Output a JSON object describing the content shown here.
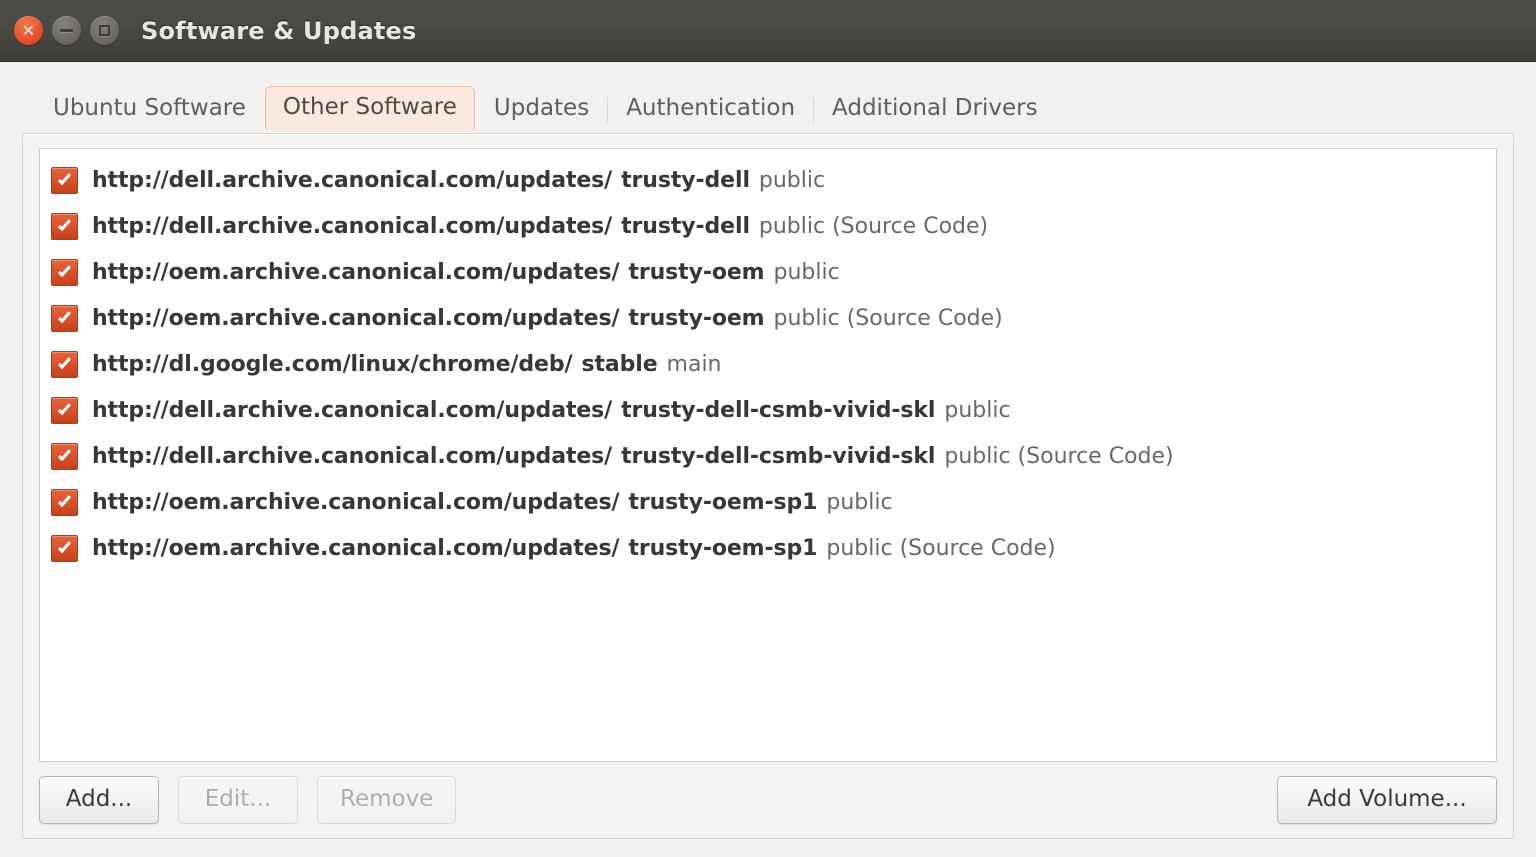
{
  "window": {
    "title": "Software & Updates",
    "controls": [
      {
        "name": "close",
        "icon": "close-icon",
        "glyph": "✕"
      },
      {
        "name": "minimize",
        "icon": "minimize-icon",
        "glyph": ""
      },
      {
        "name": "maximize",
        "icon": "maximize-icon",
        "glyph": ""
      }
    ]
  },
  "tabs": [
    {
      "label": "Ubuntu Software",
      "active": false
    },
    {
      "label": "Other Software",
      "active": true
    },
    {
      "label": "Updates",
      "active": false
    },
    {
      "label": "Authentication",
      "active": false
    },
    {
      "label": "Additional Drivers",
      "active": false
    }
  ],
  "repositories": [
    {
      "checked": true,
      "uri": "http://dell.archive.canonical.com/updates/",
      "distribution": "trusty-dell",
      "components": "public"
    },
    {
      "checked": true,
      "uri": "http://dell.archive.canonical.com/updates/",
      "distribution": "trusty-dell",
      "components": "public (Source Code)"
    },
    {
      "checked": true,
      "uri": "http://oem.archive.canonical.com/updates/",
      "distribution": "trusty-oem",
      "components": "public"
    },
    {
      "checked": true,
      "uri": "http://oem.archive.canonical.com/updates/",
      "distribution": "trusty-oem",
      "components": "public (Source Code)"
    },
    {
      "checked": true,
      "uri": "http://dl.google.com/linux/chrome/deb/",
      "distribution": "stable",
      "components": "main"
    },
    {
      "checked": true,
      "uri": "http://dell.archive.canonical.com/updates/",
      "distribution": "trusty-dell-csmb-vivid-skl",
      "components": "public"
    },
    {
      "checked": true,
      "uri": "http://dell.archive.canonical.com/updates/",
      "distribution": "trusty-dell-csmb-vivid-skl",
      "components": "public (Source Code)"
    },
    {
      "checked": true,
      "uri": "http://oem.archive.canonical.com/updates/",
      "distribution": "trusty-oem-sp1",
      "components": "public"
    },
    {
      "checked": true,
      "uri": "http://oem.archive.canonical.com/updates/",
      "distribution": "trusty-oem-sp1",
      "components": "public (Source Code)"
    }
  ],
  "buttons": {
    "add": {
      "label": "Add...",
      "enabled": true
    },
    "edit": {
      "label": "Edit...",
      "enabled": false
    },
    "remove": {
      "label": "Remove",
      "enabled": false
    },
    "add_volume": {
      "label": "Add Volume...",
      "enabled": true
    }
  },
  "colors": {
    "titlebar": "#4a4843",
    "checkbox_accent": "#d9512a",
    "active_tab_bg": "#fbe9e0",
    "active_tab_border": "#e8b9a0",
    "listview_bg": "#ffffff",
    "dialog_bg": "#f2f1f0"
  }
}
